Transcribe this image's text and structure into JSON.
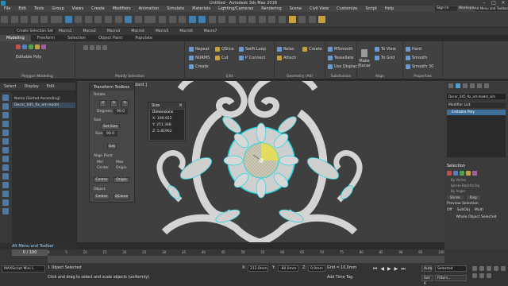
{
  "app": {
    "title": "Untitled - Autodesk 3ds Max 2018",
    "sign_in": "Sign In",
    "workspaces_label": "Workspaces:",
    "workspace_value": "Alt Menu and Toolbar"
  },
  "menu": [
    "File",
    "Edit",
    "Tools",
    "Group",
    "Views",
    "Create",
    "Modifiers",
    "Animation",
    "Simulate",
    "Materials",
    "Lighting/Cameras",
    "Rendering",
    "Scene",
    "Civil View",
    "Customize",
    "Script",
    "Help"
  ],
  "toolbar": {
    "selection_set": "Create Selection Set",
    "macros": [
      "Macro1",
      "Macro2",
      "Macro3",
      "Macro4",
      "Macro5",
      "Macro6",
      "Macro7"
    ]
  },
  "ribbon": {
    "tabs": [
      "Modeling",
      "Freeform",
      "Selection",
      "Object Paint",
      "Populate"
    ],
    "active_tab": "Modeling",
    "groups": {
      "polygon_modeling": {
        "label": "Polygon Modeling",
        "item": "Editable Poly"
      },
      "modify_selection": {
        "label": "Modify Selection"
      },
      "edit": {
        "label": "Edit",
        "items": [
          "Repeat",
          "NURMS",
          "Create",
          "QSlice",
          "Cut",
          "Swift Loop",
          "P Connect",
          "Relax",
          "Attach"
        ]
      },
      "geometry_all": {
        "label": "Geometry (All)",
        "items": [
          "Create",
          "MSmooth",
          "Tessellate",
          "Use Displac..."
        ]
      },
      "subdivision": {
        "label": "Subdivision"
      },
      "align": {
        "label": "Align",
        "items": [
          "Make Planar",
          "To View",
          "To Grid"
        ]
      },
      "properties": {
        "label": "Properties",
        "items": [
          "Hard",
          "Smooth",
          "Smooth 30"
        ]
      }
    }
  },
  "scene_explorer": {
    "tabs": [
      "Select",
      "Display",
      "Edit"
    ],
    "column_header": "Name (Sorted Ascending)",
    "items": [
      "Decor_045_fix_art-model"
    ]
  },
  "viewport": {
    "label": "[+] [Perspective] [Standard] [Default Shading]",
    "label_visible_fragment": "dard ]"
  },
  "transform_toolbox": {
    "title": "Transform Toolbox",
    "rotate_label": "Rotate",
    "degrees_label": "Degrees:",
    "degrees_value": "90.0",
    "size_label": "Size",
    "set_size": "Set Size",
    "size_value": "90.0",
    "size_field_label": "Size",
    "get_btn": "Get",
    "align_pivot_label": "Align Pivot",
    "align_options": [
      "Min",
      "Max",
      "Center",
      "Origin"
    ],
    "center_btn": "Center",
    "origin_btn": "Origin",
    "object_label": "Object",
    "object_btns": [
      "Center",
      "QClone"
    ]
  },
  "size_panel": {
    "title": "Size",
    "dimensions_label": "Dimensions",
    "x": "X:  199.922",
    "y": "Y:  251.348",
    "z": "Z:  5.81962"
  },
  "command_panel": {
    "object_name": "Decor_045_fix_art-model_sim",
    "modifier_list": "Modifier List",
    "stack_item": "Editable Poly",
    "selection_title": "Selection",
    "by_vertex": "By Vertex",
    "ignore_backfacing": "Ignore Backfacing",
    "by_angle": "By Angle:",
    "shrink": "Shrink",
    "ring": "Ring",
    "preview_selection": "Preview Selection",
    "off": "Off",
    "subobj": "SubObj",
    "multi": "Multi",
    "whole_object_selected": "Whole Object Selected"
  },
  "bottom": {
    "alt_menu": "Alt Menu and Toolbar",
    "frame": "0 / 100",
    "maxscript": "MAXScript Mini L",
    "status1": "1 Object Selected",
    "status2": "Click and drag to select and scale objects (uniformly)",
    "x_label": "X:",
    "x_value": "212.0mm",
    "y_label": "Y:",
    "y_value": "-80.0mm",
    "z_label": "Z:",
    "z_value": "0.0mm",
    "grid": "Grid = 10,0mm",
    "add_time_tag": "Add Time Tag",
    "auto": "Auto",
    "set_k": "Set K",
    "selected": "Selected",
    "filters": "Filters..."
  },
  "timeline_ticks": [
    "0",
    "5",
    "10",
    "15",
    "20",
    "25",
    "30",
    "35",
    "40",
    "45",
    "50",
    "55",
    "60",
    "65",
    "70",
    "75",
    "80",
    "85",
    "90",
    "95",
    "100"
  ],
  "colors": {
    "accent": "#3e7fb0",
    "highlight_cyan": "#20d8e0",
    "ornament": "#d6d6d6",
    "sunflower": "#e8e050"
  }
}
